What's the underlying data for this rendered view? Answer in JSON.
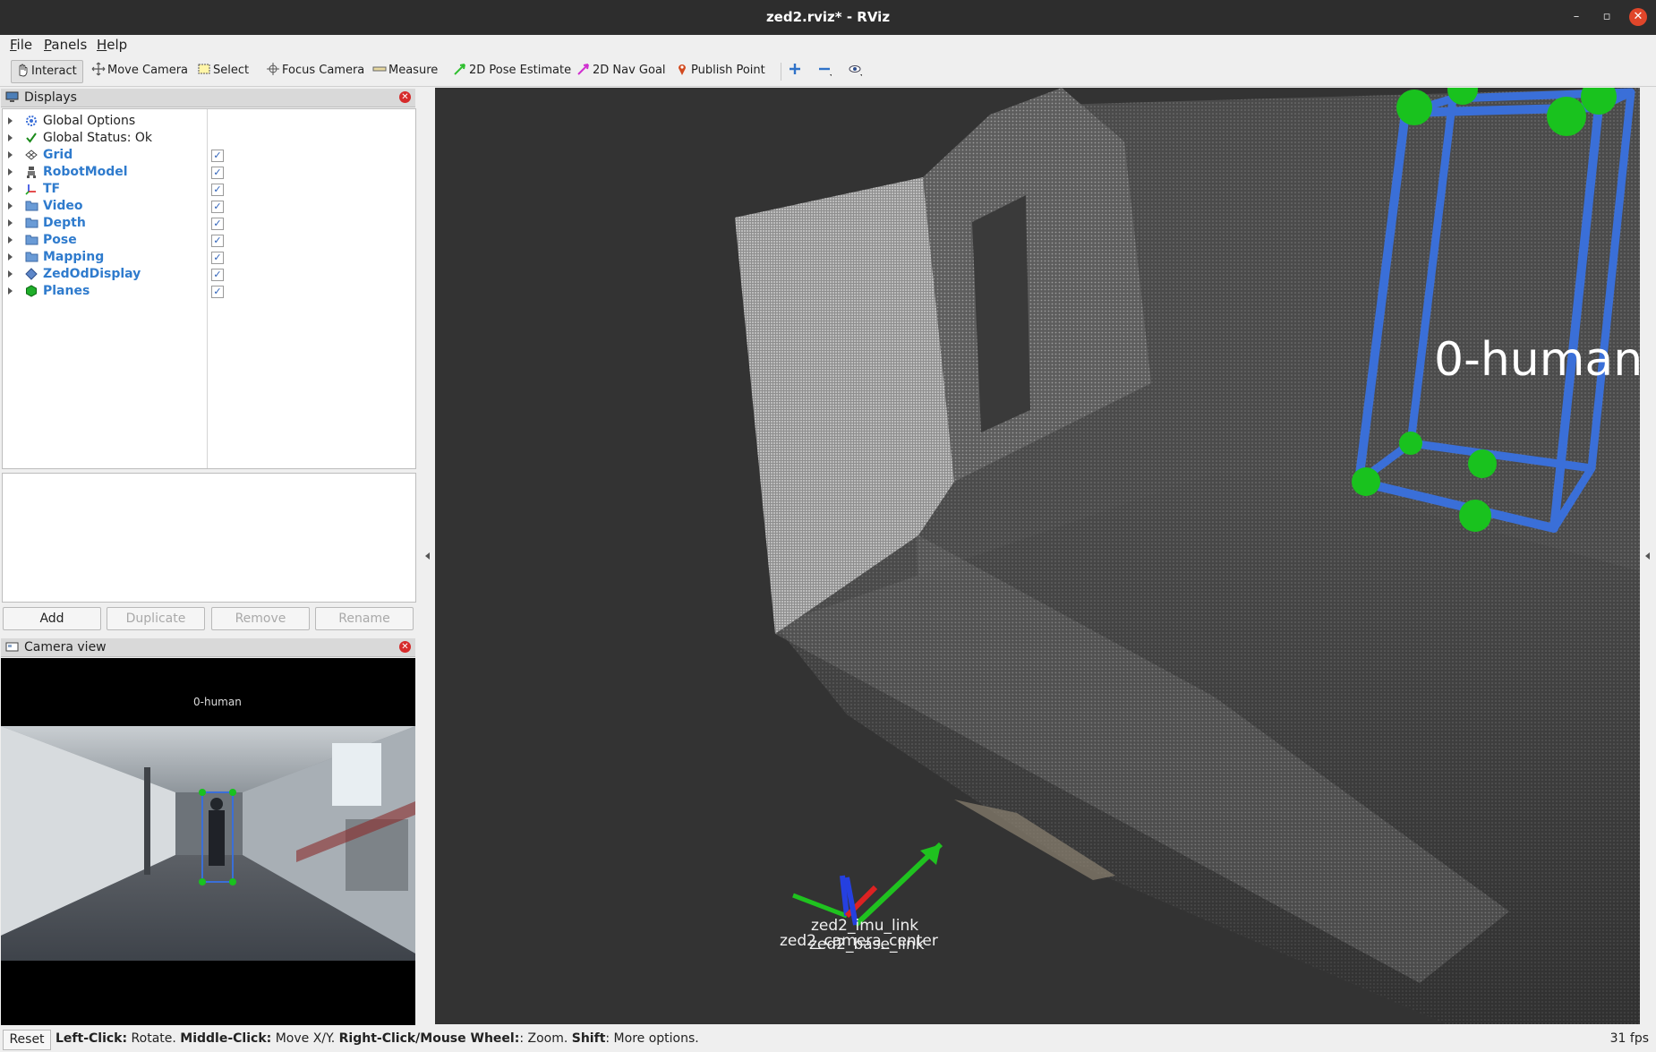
{
  "window": {
    "title": "zed2.rviz* - RViz"
  },
  "menu": {
    "file": {
      "accel": "F",
      "rest": "ile"
    },
    "panels": {
      "accel": "P",
      "rest": "anels"
    },
    "help": {
      "accel": "H",
      "rest": "elp"
    }
  },
  "toolbar": {
    "interact": "Interact",
    "move_camera": "Move Camera",
    "select": "Select",
    "focus_camera": "Focus Camera",
    "measure": "Measure",
    "pose_estimate": "2D Pose Estimate",
    "nav_goal": "2D Nav Goal",
    "publish_point": "Publish Point"
  },
  "displays": {
    "title": "Displays",
    "items": [
      {
        "label": "Global Options",
        "icon": "gear-icon",
        "blue": false,
        "checked": null
      },
      {
        "label": "Global Status: Ok",
        "icon": "checkmark-icon",
        "blue": false,
        "checked": null
      },
      {
        "label": "Grid",
        "icon": "grid-icon",
        "blue": true,
        "checked": true
      },
      {
        "label": "RobotModel",
        "icon": "robot-icon",
        "blue": true,
        "checked": true
      },
      {
        "label": "TF",
        "icon": "axes-icon",
        "blue": true,
        "checked": true
      },
      {
        "label": "Video",
        "icon": "folder-icon",
        "blue": true,
        "checked": true
      },
      {
        "label": "Depth",
        "icon": "folder-icon",
        "blue": true,
        "checked": true
      },
      {
        "label": "Pose",
        "icon": "folder-icon",
        "blue": true,
        "checked": true
      },
      {
        "label": "Mapping",
        "icon": "folder-icon",
        "blue": true,
        "checked": true
      },
      {
        "label": "ZedOdDisplay",
        "icon": "diamond-icon",
        "blue": true,
        "checked": true
      },
      {
        "label": "Planes",
        "icon": "hexagon-icon",
        "blue": true,
        "checked": true
      }
    ],
    "buttons": {
      "add": "Add",
      "duplicate": "Duplicate",
      "remove": "Remove",
      "rename": "Rename"
    }
  },
  "camera_view": {
    "title": "Camera view",
    "label": "0-human"
  },
  "viewport": {
    "object_label": "0-human",
    "tf_labels": {
      "a": "zed2_imu_link",
      "b": "zed2_camera_center",
      "c": "zed2_base_link"
    }
  },
  "status": {
    "reset": "Reset",
    "hint_parts": [
      {
        "bold": "Left-Click:",
        "text": " Rotate. "
      },
      {
        "bold": "Middle-Click:",
        "text": " Move X/Y. "
      },
      {
        "bold": "Right-Click/Mouse Wheel:",
        "text": ": Zoom. "
      },
      {
        "bold": "Shift",
        "text": ": More options."
      }
    ],
    "fps": "31 fps"
  },
  "colors": {
    "bbox": "#3a6fd8",
    "keypoint": "#19c21e",
    "viewport_bg": "#333333",
    "display_label": "#2f7bcd"
  }
}
